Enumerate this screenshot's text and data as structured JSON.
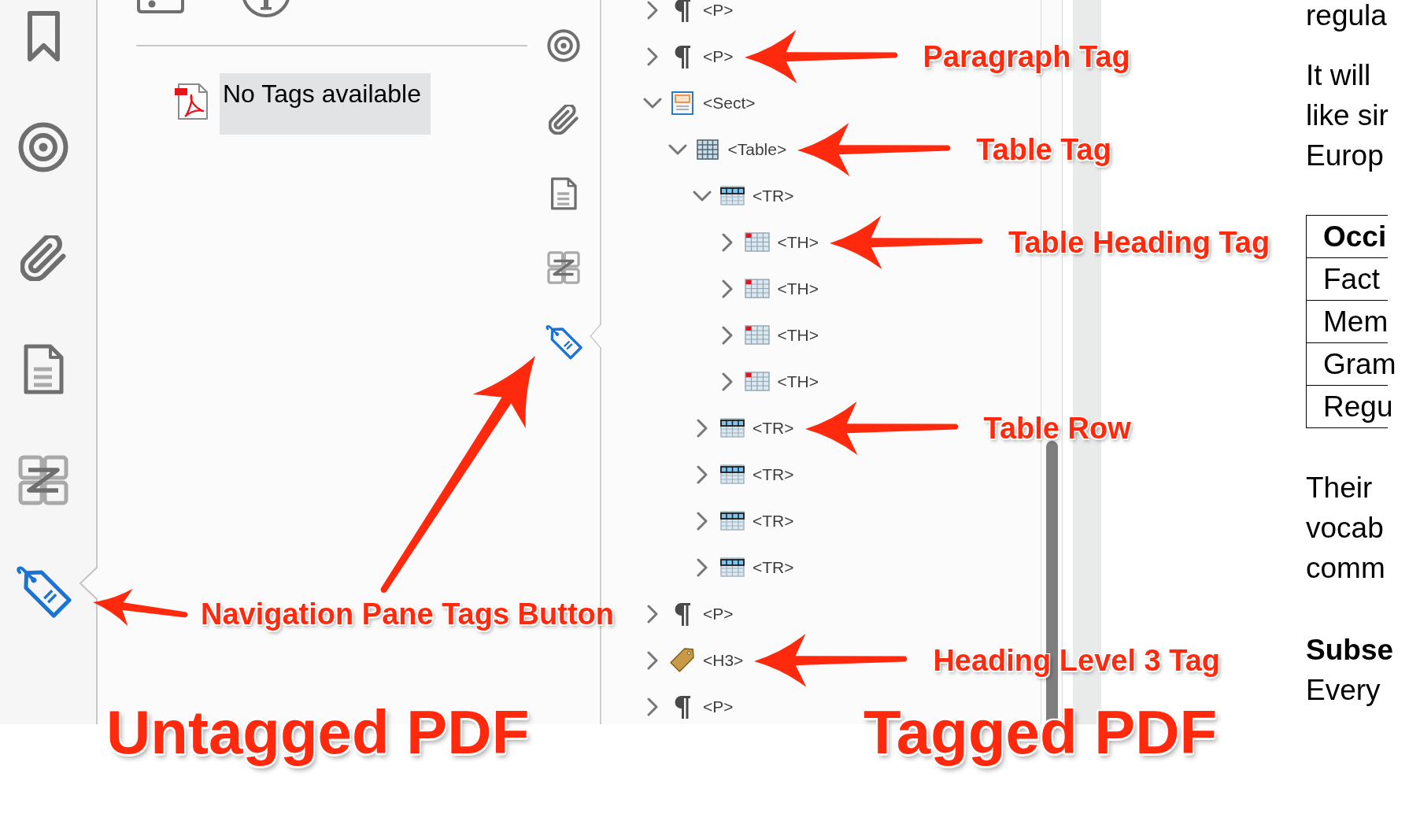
{
  "untagged_pdf": {
    "sidebar_buttons": [
      {
        "kind": "bookmark",
        "selected": false
      },
      {
        "kind": "target",
        "selected": false
      },
      {
        "kind": "attachment",
        "selected": false
      },
      {
        "kind": "page",
        "selected": false
      },
      {
        "kind": "compare",
        "selected": false
      },
      {
        "kind": "tag",
        "selected": true
      }
    ],
    "tags_panel": {
      "items": [
        {
          "label": "No Tags available",
          "selected": true
        }
      ]
    },
    "caption": "Untagged PDF"
  },
  "tagged_pdf": {
    "sidebar_buttons": [
      {
        "kind": "target",
        "selected": false
      },
      {
        "kind": "attachment",
        "selected": false
      },
      {
        "kind": "page",
        "selected": false
      },
      {
        "kind": "compare",
        "selected": false
      },
      {
        "kind": "tag",
        "selected": true
      }
    ],
    "tags_tree": [
      {
        "tag": "<P>",
        "kind": "paragraph",
        "expanded": false
      },
      {
        "tag": "<P>",
        "kind": "paragraph",
        "expanded": false,
        "callout": "Paragraph Tag"
      },
      {
        "tag": "<Sect>",
        "kind": "section",
        "expanded": true,
        "children": [
          {
            "tag": "<Table>",
            "kind": "table",
            "expanded": true,
            "callout": "Table Tag",
            "children": [
              {
                "tag": "<TR>",
                "kind": "table_row",
                "expanded": true,
                "children": [
                  {
                    "tag": "<TH>",
                    "kind": "table_heading",
                    "expanded": false,
                    "callout": "Table Heading Tag"
                  },
                  {
                    "tag": "<TH>",
                    "kind": "table_heading",
                    "expanded": false
                  },
                  {
                    "tag": "<TH>",
                    "kind": "table_heading",
                    "expanded": false
                  },
                  {
                    "tag": "<TH>",
                    "kind": "table_heading",
                    "expanded": false
                  }
                ]
              },
              {
                "tag": "<TR>",
                "kind": "table_row",
                "expanded": false,
                "callout": "Table Row"
              },
              {
                "tag": "<TR>",
                "kind": "table_row",
                "expanded": false
              },
              {
                "tag": "<TR>",
                "kind": "table_row",
                "expanded": false
              },
              {
                "tag": "<TR>",
                "kind": "table_row",
                "expanded": false
              }
            ]
          }
        ]
      },
      {
        "tag": "<P>",
        "kind": "paragraph",
        "expanded": false
      },
      {
        "tag": "<H3>",
        "kind": "heading",
        "expanded": false,
        "callout": "Heading Level 3 Tag"
      },
      {
        "tag": "<P>",
        "kind": "paragraph",
        "expanded": false
      }
    ],
    "document": {
      "blocks": [
        {
          "kind": "paragraph",
          "lines": [
            "regula"
          ]
        },
        {
          "kind": "paragraph",
          "lines": [
            "It will",
            "like sir",
            "Europ"
          ]
        },
        {
          "kind": "table",
          "header": [
            "Occi"
          ],
          "rows": [
            [
              "Fact"
            ],
            [
              "Mem"
            ],
            [
              "Gram"
            ],
            [
              "Regu"
            ]
          ]
        },
        {
          "kind": "paragraph",
          "lines": [
            "Their",
            "vocab",
            "comm"
          ]
        },
        {
          "kind": "heading",
          "lines": [
            "Subse"
          ]
        },
        {
          "kind": "paragraph",
          "lines": [
            "Every"
          ]
        }
      ]
    },
    "caption": "Tagged PDF"
  },
  "callouts": [
    {
      "text": "Navigation Pane Tags Button"
    }
  ]
}
